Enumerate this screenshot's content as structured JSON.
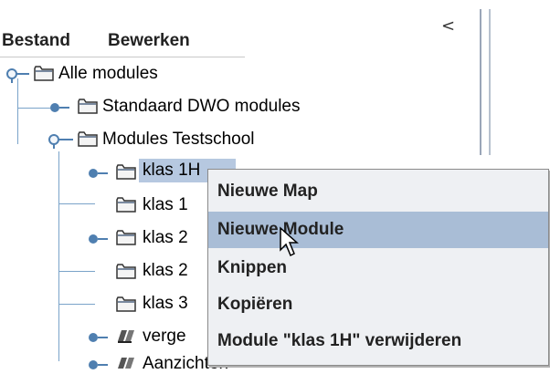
{
  "menubar": {
    "file": "Bestand",
    "edit": "Bewerken"
  },
  "collapse_glyph": "<",
  "tree": {
    "root": "Alle modules",
    "standard": "Standaard DWO modules",
    "school": "Modules Testschool",
    "klas1h": "klas 1H",
    "klas1b": "klas 1",
    "klas2a": "klas 2",
    "klas2b": "klas 2",
    "klas3": "klas 3",
    "verge": "verge",
    "aanzichten": "Aanzichten"
  },
  "context_menu": {
    "items": [
      "Nieuwe Map",
      "Nieuwe Module",
      "Knippen",
      "Kopiëren",
      "Module \"klas 1H\" verwijderen"
    ],
    "hovered_index": 1
  },
  "colors": {
    "selection": "#b6c8e0",
    "menu_hover": "#a9bdd6",
    "tree_line": "#7aa3c9"
  }
}
